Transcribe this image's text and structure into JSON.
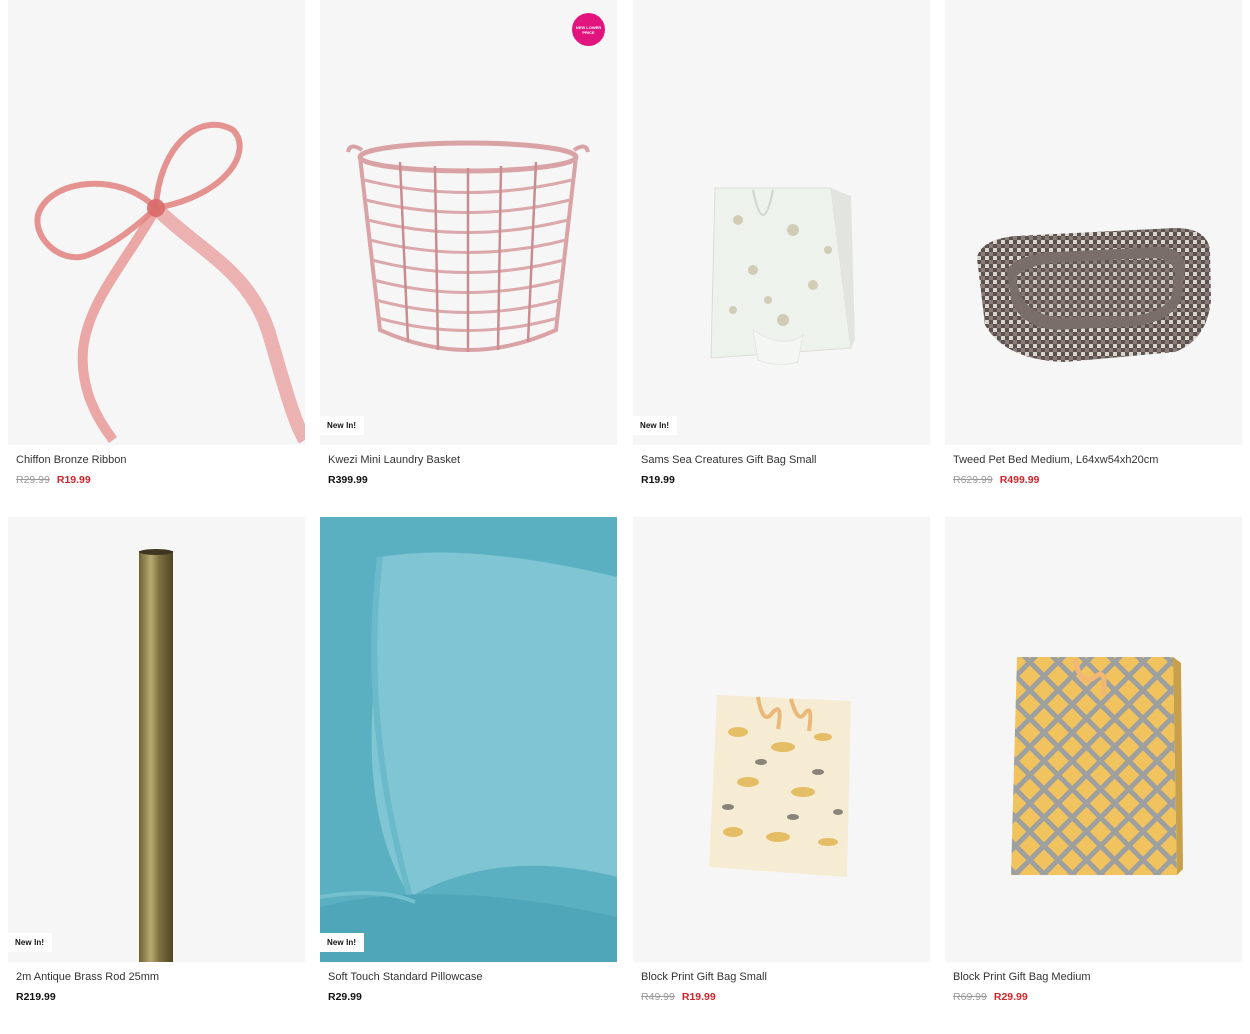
{
  "colors": {
    "sale": "#d1232a",
    "badge_pill": "#e2147e",
    "image_bg": "#f6f6f6"
  },
  "products": [
    {
      "name": "Chiffon Bronze Ribbon",
      "was": "R29.99",
      "price": "R19.99",
      "badge": ""
    },
    {
      "name": "Kwezi Mini Laundry Basket",
      "was": "",
      "price": "R399.99",
      "badge": "New In!",
      "pill": "NEW LOWER PRICE"
    },
    {
      "name": "Sams Sea Creatures Gift Bag Small",
      "was": "",
      "price": "R19.99",
      "badge": "New In!"
    },
    {
      "name": "Tweed Pet Bed Medium, L64xw54xh20cm",
      "was": "R629.99",
      "price": "R499.99",
      "badge": ""
    },
    {
      "name": "2m Antique Brass Rod 25mm",
      "was": "",
      "price": "R219.99",
      "badge": "New In!"
    },
    {
      "name": "Soft Touch Standard Pillowcase",
      "was": "",
      "price": "R29.99",
      "badge": "New In!"
    },
    {
      "name": "Block Print Gift Bag Small",
      "was": "R49.99",
      "price": "R19.99",
      "badge": ""
    },
    {
      "name": "Block Print Gift Bag Medium",
      "was": "R69.99",
      "price": "R29.99",
      "badge": ""
    }
  ]
}
